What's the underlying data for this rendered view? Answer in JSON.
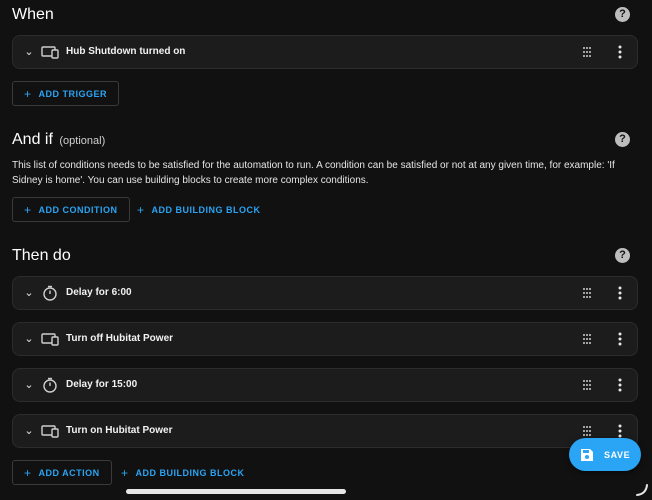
{
  "when": {
    "title": "When",
    "triggers": [
      {
        "label": "Hub Shutdown turned on",
        "icon": "device-icon"
      }
    ],
    "add_trigger_label": "ADD TRIGGER"
  },
  "and_if": {
    "title": "And if",
    "optional_label": "(optional)",
    "description": "This list of conditions needs to be satisfied for the automation to run. A condition can be satisfied or not at any given time, for example: 'If Sidney is home'. You can use building blocks to create more complex conditions.",
    "add_condition_label": "ADD CONDITION",
    "add_building_block_label": "ADD BUILDING BLOCK"
  },
  "then_do": {
    "title": "Then do",
    "actions": [
      {
        "label": "Delay for 6:00",
        "icon": "timer-icon"
      },
      {
        "label": "Turn off Hubitat Power",
        "icon": "device-icon"
      },
      {
        "label": "Delay for 15:00",
        "icon": "timer-icon"
      },
      {
        "label": "Turn on Hubitat Power",
        "icon": "device-icon"
      }
    ],
    "add_action_label": "ADD ACTION",
    "add_building_block_label": "ADD BUILDING BLOCK"
  },
  "help_glyph": "?",
  "save_label": "SAVE",
  "colors": {
    "accent": "#2aa4f4",
    "background": "#111111",
    "card": "#1c1c1c"
  }
}
